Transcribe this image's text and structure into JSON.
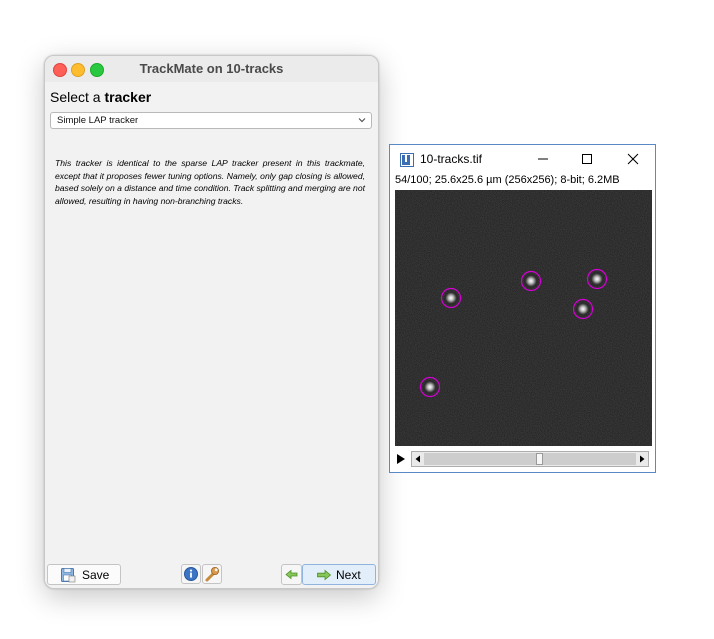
{
  "trackmate": {
    "window_title": "TrackMate on 10-tracks",
    "heading_prefix": "Select a ",
    "heading_bold": "tracker",
    "tracker_select": {
      "selected": "Simple LAP tracker"
    },
    "description": "This tracker is identical to the sparse LAP tracker present in this trackmate, except that it proposes fewer tuning options. Namely, only gap closing is allowed, based solely on a distance and time condition. Track splitting and merging are not allowed, resulting in having non-branching tracks.",
    "buttons": {
      "save_label": "Save",
      "next_label": "Next"
    }
  },
  "imagej": {
    "window_title": "10-tracks.tif",
    "info": "54/100; 25.6x25.6 µm (256x256); 8-bit; 6.2MB",
    "frame": 54,
    "total_frames": 100,
    "spot_color": "#d400d4"
  },
  "colors": {
    "accent_next": "#e3eefb",
    "ij_border": "#5a8ac6"
  }
}
